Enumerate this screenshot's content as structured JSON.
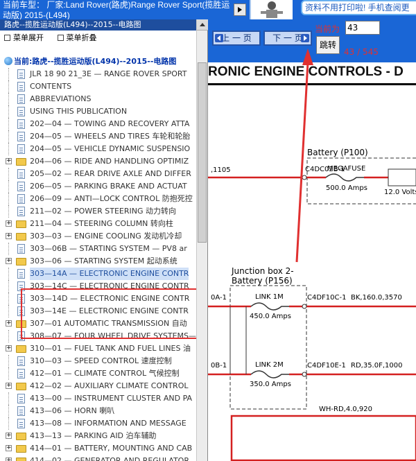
{
  "header": {
    "car_text": "当前车型：  厂家:Land Rover(路虎)Range Rover Sport(揽胜运动版) 2015-(L494)",
    "ad_text": "资料不用打印啦! 手机查阅更"
  },
  "tree": {
    "title": "路虎--揽胜运动版(L494)--2015--电路图",
    "expand_label": "菜单展开",
    "collapse_label": "菜单折叠",
    "root_label": "当前:路虎--揽胜运动版(L494)--2015--电路图",
    "items": [
      {
        "label": "JLR 18 90 21_3E — RANGE ROVER SPORT",
        "kind": "doc",
        "expandable": false,
        "selected": false
      },
      {
        "label": "CONTENTS",
        "kind": "doc",
        "expandable": false,
        "selected": false
      },
      {
        "label": "ABBREVIATIONS",
        "kind": "doc",
        "expandable": false,
        "selected": false
      },
      {
        "label": "USING THIS PUBLICATION",
        "kind": "doc",
        "expandable": false,
        "selected": false
      },
      {
        "label": "202—04 — TOWING AND RECOVERY ATTA",
        "kind": "doc",
        "expandable": false,
        "selected": false
      },
      {
        "label": "204—05 — WHEELS AND TIRES 车轮和轮胎",
        "kind": "doc",
        "expandable": false,
        "selected": false
      },
      {
        "label": "204—05 — VEHICLE DYNAMIC SUSPENSIO",
        "kind": "doc",
        "expandable": false,
        "selected": false
      },
      {
        "label": "204—06 — RIDE AND HANDLING OPTIMIZ",
        "kind": "folder",
        "expandable": true,
        "selected": false
      },
      {
        "label": "205—02 — REAR DRIVE AXLE AND DIFFER",
        "kind": "doc",
        "expandable": false,
        "selected": false
      },
      {
        "label": "206—05 — PARKING BRAKE AND ACTUAT",
        "kind": "doc",
        "expandable": false,
        "selected": false
      },
      {
        "label": "206—09 — ANTI—LOCK CONTROL 防抱死控",
        "kind": "doc",
        "expandable": false,
        "selected": false
      },
      {
        "label": "211—02 — POWER STEERING 动力转向",
        "kind": "doc",
        "expandable": false,
        "selected": false
      },
      {
        "label": "211—04 — STEERING COLUMN 转向柱",
        "kind": "folder",
        "expandable": true,
        "selected": false
      },
      {
        "label": "303—03 — ENGINE COOLING 发动机冷却",
        "kind": "folder",
        "expandable": true,
        "selected": false
      },
      {
        "label": "303—06B — STARTING SYSTEM — PV8 ar",
        "kind": "doc",
        "expandable": false,
        "selected": false
      },
      {
        "label": "303—06 — STARTING SYSTEM 起动系统",
        "kind": "folder",
        "expandable": true,
        "selected": false
      },
      {
        "label": "303—14A — ELECTRONIC ENGINE CONTR",
        "kind": "doc",
        "expandable": false,
        "selected": true
      },
      {
        "label": "303—14C — ELECTRONIC ENGINE CONTR",
        "kind": "doc",
        "expandable": false,
        "selected": false
      },
      {
        "label": "303—14D — ELECTRONIC ENGINE CONTR",
        "kind": "doc",
        "expandable": false,
        "selected": false
      },
      {
        "label": "303—14E — ELECTRONIC ENGINE CONTR",
        "kind": "doc",
        "expandable": false,
        "selected": false
      },
      {
        "label": "307—01 AUTOMATIC TRANSMISSION 自动",
        "kind": "folder",
        "expandable": true,
        "selected": false
      },
      {
        "label": "308—07 — FOUR WHEEL DRIVE SYSTEMS—",
        "kind": "doc",
        "expandable": false,
        "selected": false
      },
      {
        "label": "310—01 — FUEL TANK AND FUEL LINES 油",
        "kind": "folder",
        "expandable": true,
        "selected": false
      },
      {
        "label": "310—03 — SPEED CONTROL 速度控制",
        "kind": "doc",
        "expandable": false,
        "selected": false
      },
      {
        "label": "412—01 — CLIMATE CONTROL 气候控制",
        "kind": "doc",
        "expandable": false,
        "selected": false
      },
      {
        "label": "412—02 — AUXILIARY CLIMATE CONTROL",
        "kind": "folder",
        "expandable": true,
        "selected": false
      },
      {
        "label": "413—00 — INSTRUMENT CLUSTER AND PA",
        "kind": "doc",
        "expandable": false,
        "selected": false
      },
      {
        "label": "413—06 — HORN 喇叭",
        "kind": "doc",
        "expandable": false,
        "selected": false
      },
      {
        "label": "413—08 — INFORMATION AND MESSAGE",
        "kind": "doc",
        "expandable": false,
        "selected": false
      },
      {
        "label": "413—13 — PARKING AID 泊车辅助",
        "kind": "folder",
        "expandable": true,
        "selected": false
      },
      {
        "label": "414—01 — BATTERY, MOUNTING AND CAB",
        "kind": "folder",
        "expandable": true,
        "selected": false
      },
      {
        "label": "414—02 — GENERATOR AND REGULATOR",
        "kind": "folder",
        "expandable": true,
        "selected": false
      }
    ]
  },
  "nav": {
    "prev_label": "上 一 页",
    "next_label": "下 一 页",
    "current_label": "当前为",
    "page_value": "43",
    "go_label": "跳转",
    "page_count": "43 / 545"
  },
  "diagram": {
    "title": "RONIC ENGINE CONTROLS - D",
    "labels": {
      "wire_1105": ",1105",
      "connector_c4dc02b1": "C4DC02B-1",
      "megafuse": "MEGAFUSE",
      "megafuse_rating": "500.0 Amps",
      "volts": "12.0 Volts",
      "battery": "Battery (P100)",
      "junction_line1": "Junction box 2-",
      "junction_line2": "Battery (P156)",
      "wire_a1": "0A-1",
      "link_1m": "LINK 1M",
      "link_1m_rating": "450.0 Amps",
      "connector_c4df10c1": "C4DF10C-1",
      "wire_bk": "BK,160.0,3570",
      "wire_b1": "0B-1",
      "link_2m": "LINK 2M",
      "link_2m_rating": "350.0 Amps",
      "connector_c4df10e1": "C4DF10E-1",
      "wire_rd": "RD,35.0F,1000",
      "wire_whrd": "WH-RD,4.0,920"
    }
  },
  "colors": {
    "header_bg": "#1a66d6",
    "tree_title_bg": "#1e4e9e",
    "highlight_red": "#e03030",
    "wire_red": "#d42020"
  }
}
